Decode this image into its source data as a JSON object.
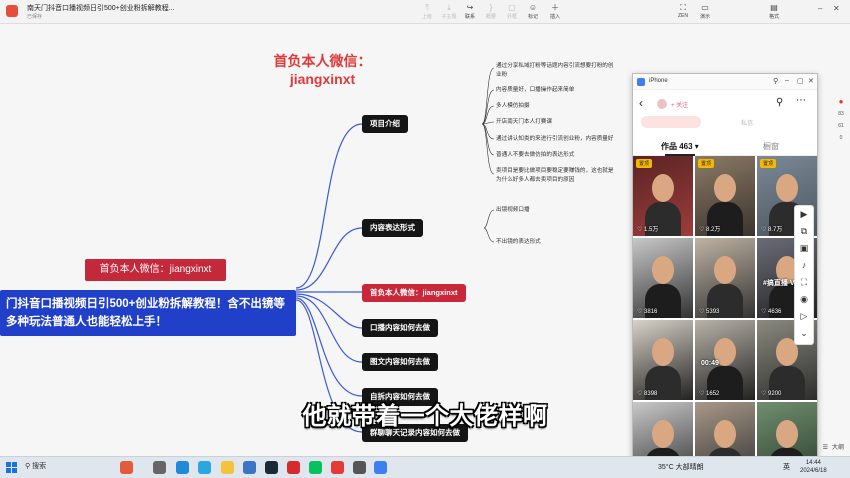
{
  "app": {
    "title": "南天门抖音口播视频日引500+创业粉拆解教程...",
    "subtitle": "已保存",
    "toolbar": [
      {
        "label": "上级",
        "icon": "parent-icon"
      },
      {
        "label": "子主题",
        "icon": "child-icon"
      },
      {
        "label": "联系",
        "icon": "link-icon"
      },
      {
        "label": "概要",
        "icon": "summary-icon"
      },
      {
        "label": "外框",
        "icon": "frame-icon"
      },
      {
        "label": "标记",
        "icon": "mark-icon"
      },
      {
        "label": "插入",
        "icon": "insert-icon"
      }
    ],
    "right_tools": [
      {
        "label": "ZEN",
        "icon": "zen-icon"
      },
      {
        "label": "演示",
        "icon": "present-icon"
      },
      {
        "label": "格式",
        "icon": "format-icon"
      }
    ]
  },
  "mindmap": {
    "watermark_title_line1": "首负本人微信：",
    "watermark_title_line2": "jiangxinxt",
    "root": "门抖音口播视频日引500+创业粉拆解教程！含不出镜等多种玩法普通人也能轻松上手！",
    "red_tag": "首负本人微信：jiangxinxt",
    "branches": [
      {
        "label": "项目介绍",
        "style": "dark"
      },
      {
        "label": "内容表达形式",
        "style": "dark"
      },
      {
        "label": "首负本人微信：jiangxinxt",
        "style": "red"
      },
      {
        "label": "口播内容如何去做",
        "style": "dark"
      },
      {
        "label": "图文内容如何去做",
        "style": "dark"
      },
      {
        "label": "自拆内容如何去做",
        "style": "dark"
      },
      {
        "label": "群聊聊天记录内容如何去做",
        "style": "dark"
      }
    ],
    "leaves_intro": [
      "通过分享私域打粉等话题内容引流想要打粉的创",
      "业粉",
      "内容质量好，口播操作起来简单",
      "多人模仿拍摄",
      "开店南天门本人打赛课",
      "通过讲认知类的来进行引流创业粉，内容质量好",
      "普通人不要去做仿拍的表达形式",
      "卖项目是要比做项目要稳定要赚钱的，这也就是",
      "为什么好多人都去卖项目的原因"
    ],
    "leaves_expression": [
      "出镜视频口播",
      "不出镜的表达形式"
    ],
    "caption": "他就带着一个大佬样啊",
    "zoom_label": "大纲"
  },
  "phone": {
    "window_title": "iPhone",
    "follow_label": "+ 关注",
    "tab_works": "作品 463 ▾",
    "tab_likes": "橱窗",
    "blur_tab": "私信",
    "videos": [
      {
        "likes": "1.5万",
        "pinned": true,
        "pin_label": "置顶"
      },
      {
        "likes": "8.2万",
        "pinned": true,
        "pin_label": "置顶"
      },
      {
        "likes": "8.7万",
        "pinned": true,
        "pin_label": "置顶"
      },
      {
        "likes": "3816",
        "pinned": false
      },
      {
        "likes": "5393",
        "pinned": false
      },
      {
        "likes": "4636",
        "pinned": false,
        "overlay_text": "#搞直播 Vlog"
      },
      {
        "likes": "8398",
        "pinned": false
      },
      {
        "likes": "1652",
        "pinned": false,
        "overlay_text": "00:49"
      },
      {
        "likes": "9200",
        "pinned": false
      },
      {
        "likes": "",
        "pinned": false
      },
      {
        "likes": "",
        "pinned": false
      },
      {
        "likes": "",
        "pinned": false
      }
    ],
    "edge_labels": [
      "83",
      "61",
      "0"
    ]
  },
  "taskbar": {
    "search": "搜索",
    "weather": "35°C 大部晴朗",
    "lang": "英",
    "time": "14:44",
    "date": "2024/6/18"
  },
  "colors": {
    "accent_red": "#e13939",
    "node_dark": "#151515",
    "root_blue": "#2140c9",
    "branch_line": "#3b5bd9"
  }
}
